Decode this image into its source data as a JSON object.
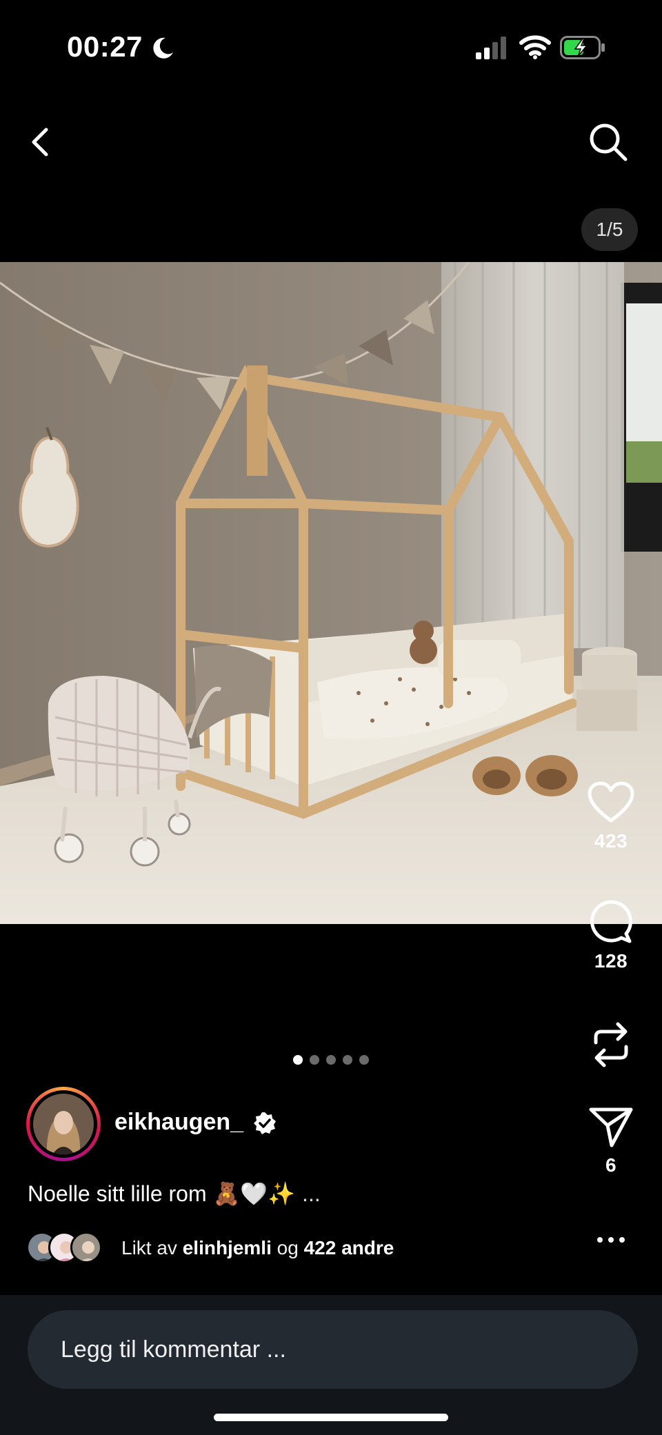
{
  "status_bar": {
    "time": "00:27",
    "focus_icon": "moon-icon",
    "signal_icon": "cellular-signal-icon",
    "wifi_icon": "wifi-icon",
    "battery_icon": "battery-charging-icon",
    "battery_color": "#32d74b"
  },
  "header": {
    "back_icon": "chevron-left-icon",
    "search_icon": "search-icon",
    "page_counter": "1/5"
  },
  "post": {
    "image_alt": "Children's bedroom with wooden house bed frame, bunting, wicker doll pram, pear mirror and teddy slippers",
    "carousel": {
      "total": 5,
      "current": 1
    },
    "author": {
      "username": "eikhaugen_",
      "verified": true
    },
    "caption": "Noelle sitt lille rom 🧸🤍✨",
    "caption_more": "...",
    "likes": {
      "prefix": "Likt av",
      "user": "elinhjemli",
      "joiner": "og",
      "others": "422 andre"
    }
  },
  "actions": {
    "like": {
      "icon": "heart-icon",
      "count": "423"
    },
    "comment": {
      "icon": "comment-bubble-icon",
      "count": "128"
    },
    "repost": {
      "icon": "repost-icon"
    },
    "share": {
      "icon": "paper-plane-icon",
      "count": "6"
    },
    "more": {
      "icon": "more-dots-icon"
    }
  },
  "comment_box": {
    "placeholder": "Legg til kommentar ..."
  },
  "colors": {
    "background": "#000000",
    "bottom_bar": "#12161a",
    "comment_field": "#232a31",
    "wall": "#8b7e70",
    "rug": "#e3ddd2",
    "wood": "#d2ac7a"
  }
}
